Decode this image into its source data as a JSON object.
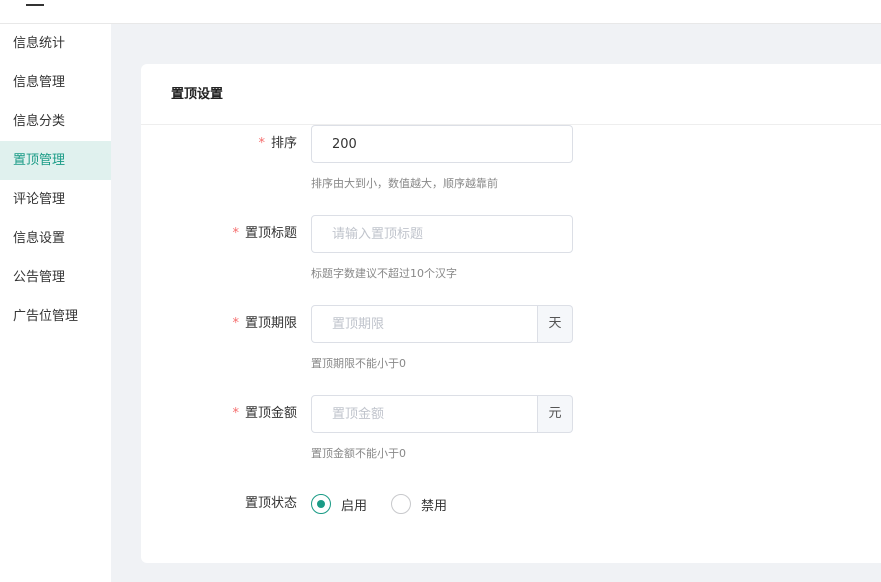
{
  "sidebar": {
    "items": [
      {
        "label": "信息统计"
      },
      {
        "label": "信息管理"
      },
      {
        "label": "信息分类"
      },
      {
        "label": "置顶管理",
        "active": true
      },
      {
        "label": "评论管理"
      },
      {
        "label": "信息设置"
      },
      {
        "label": "公告管理"
      },
      {
        "label": "广告位管理"
      }
    ]
  },
  "card": {
    "title": "置顶设置"
  },
  "form": {
    "sort": {
      "label": "排序",
      "value": "200",
      "hint": "排序由大到小，数值越大，顺序越靠前"
    },
    "title": {
      "label": "置顶标题",
      "placeholder": "请输入置顶标题",
      "hint": "标题字数建议不超过10个汉字"
    },
    "period": {
      "label": "置顶期限",
      "placeholder": "置顶期限",
      "suffix": "天",
      "hint": "置顶期限不能小于0"
    },
    "amount": {
      "label": "置顶金额",
      "placeholder": "置顶金额",
      "suffix": "元",
      "hint": "置顶金额不能小于0"
    },
    "status": {
      "label": "置顶状态",
      "options": [
        "启用",
        "禁用"
      ],
      "selected": "启用"
    }
  },
  "colors": {
    "accent": "#1a9b86",
    "required": "#f56c6c",
    "active_bg": "#e0f1ee"
  },
  "icons": {
    "menu_toggle": "menu-icon"
  }
}
